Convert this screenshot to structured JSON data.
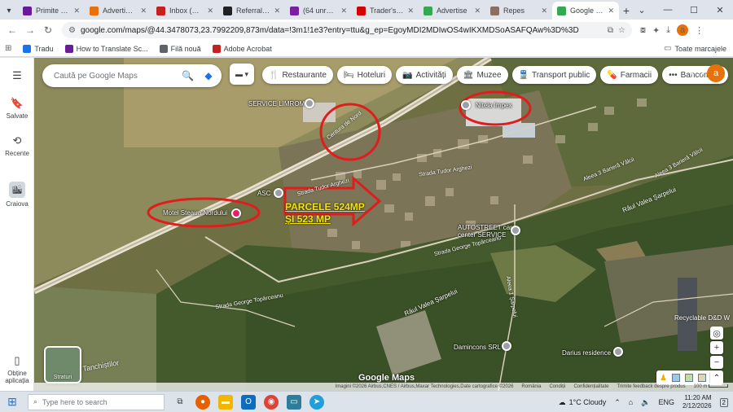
{
  "tabs": [
    {
      "title": "Primite - com",
      "color": "#6a1b9a"
    },
    {
      "title": "Advertise Ta",
      "color": "#e8710a"
    },
    {
      "title": "Inbox (805,6",
      "color": "#c5221f"
    },
    {
      "title": "Referrals - D",
      "color": "#202124"
    },
    {
      "title": "(64 unread) -",
      "color": "#7b1fa2"
    },
    {
      "title": "Trader's Hub",
      "color": "#d50000"
    },
    {
      "title": "Advertise",
      "color": "#34a853"
    },
    {
      "title": "Repes",
      "color": "#8d6e63"
    },
    {
      "title": "Google Maps",
      "color": "#34a853",
      "active": true
    }
  ],
  "address": {
    "url": "google.com/maps/@44.3478073,23.7992209,873m/data=!3m1!1e3?entry=ttu&g_ep=EgoyMDI2MDIwOS4wIKXMDSoASAFQAw%3D%3D"
  },
  "bookmarks": [
    {
      "label": "Tradu",
      "color": "#1a73e8"
    },
    {
      "label": "How to Translate Sc...",
      "color": "#6a1b9a"
    },
    {
      "label": "Filă nouă",
      "color": "#5f6368"
    },
    {
      "label": "Adobe Acrobat",
      "color": "#c5221f"
    }
  ],
  "bookmarks_right": "Toate marcajele",
  "rail": {
    "saved": "Salvate",
    "recent": "Recente",
    "place": "Craiova",
    "get_app": "Obține aplicația"
  },
  "search": {
    "placeholder": "Caută pe Google Maps"
  },
  "chips": [
    {
      "label": "Restaurante",
      "icon": "🍴"
    },
    {
      "label": "Hoteluri",
      "icon": "🛏"
    },
    {
      "label": "Activități",
      "icon": "📷"
    },
    {
      "label": "Muzee",
      "icon": "🏛"
    },
    {
      "label": "Transport public",
      "icon": "🚆"
    },
    {
      "label": "Farmacii",
      "icon": "💊"
    },
    {
      "label": "Bancomate",
      "icon": "•••"
    }
  ],
  "avatar_letter": "a",
  "places": {
    "service_limrom": "SERVICE LIMROM",
    "nitela": "Nitela Impex",
    "motel": "Motel Steaua Nordului",
    "asc": "ASC",
    "autostreet": "AUTOSTREET car center SERVICE",
    "damincons": "Damincons SRL",
    "darius": "Darius residence",
    "recyclable": "Recyclable D&D W"
  },
  "streets": {
    "centura": "Centura de Nord",
    "tudor_arghezi_1": "Strada Tudor Arghezi",
    "tudor_arghezi_2": "Strada Tudor Arghezi",
    "george_toparceanu_1": "Strada George Topârceanu",
    "george_toparceanu_2": "Strada George Topârceanu",
    "aleea_3_valcii_1": "Aleea 3 Barieră Vâlcii",
    "aleea_3_valcii_2": "Aleea 3 Barieră Vâlcii",
    "valea_sarpelui_1": "Râul Valea Șarpelui",
    "valea_sarpelui_2": "Râul Valea Șarpelui",
    "aleea_1_sarpelui": "Aleea 1 Șarpelui",
    "tanchistilor": "ul Tanchiștilor"
  },
  "annotation": {
    "line1": "PARCELE 524MP",
    "line2": "ȘI 523 MP"
  },
  "layer_toggle": "Straturi",
  "google_logo": "Google Maps",
  "attribution": {
    "imagery": "Imagini ©2026 Airbus,CNES / Airbus,Maxar Technologies,Date cartografice ©2026",
    "country": "România",
    "terms": "Condiții",
    "privacy": "Confidențialitate",
    "feedback": "Trimite feedback despre produs",
    "scale": "100 m"
  },
  "taskbar": {
    "search_placeholder": "Type here to search",
    "weather": "1°C  Cloudy",
    "lang": "ENG",
    "time": "11:20 AM",
    "date": "2/12/2026",
    "notif": "2"
  }
}
